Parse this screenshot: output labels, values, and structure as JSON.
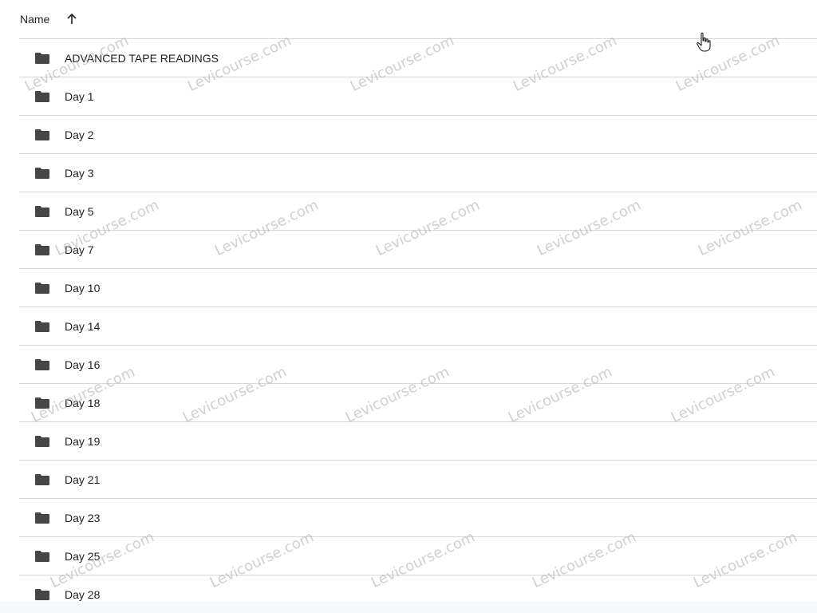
{
  "header": {
    "name_label": "Name",
    "sort_icon": "arrow-up-icon"
  },
  "folder_icon": "folder-icon",
  "folders": [
    {
      "label": "ADVANCED TAPE READINGS"
    },
    {
      "label": "Day 1"
    },
    {
      "label": "Day 2"
    },
    {
      "label": "Day 3"
    },
    {
      "label": "Day 5"
    },
    {
      "label": "Day 7"
    },
    {
      "label": "Day 10"
    },
    {
      "label": "Day 14"
    },
    {
      "label": "Day 16"
    },
    {
      "label": "Day 18"
    },
    {
      "label": "Day 19"
    },
    {
      "label": "Day 21"
    },
    {
      "label": "Day 23"
    },
    {
      "label": "Day 25"
    },
    {
      "label": "Day 28"
    }
  ],
  "watermark": {
    "text": "Levicourse.com"
  },
  "cursor_icon": "hand-pointer-icon",
  "colors": {
    "folder": "#444746",
    "divider": "#d7d7d7",
    "text": "#1f1f1f"
  }
}
